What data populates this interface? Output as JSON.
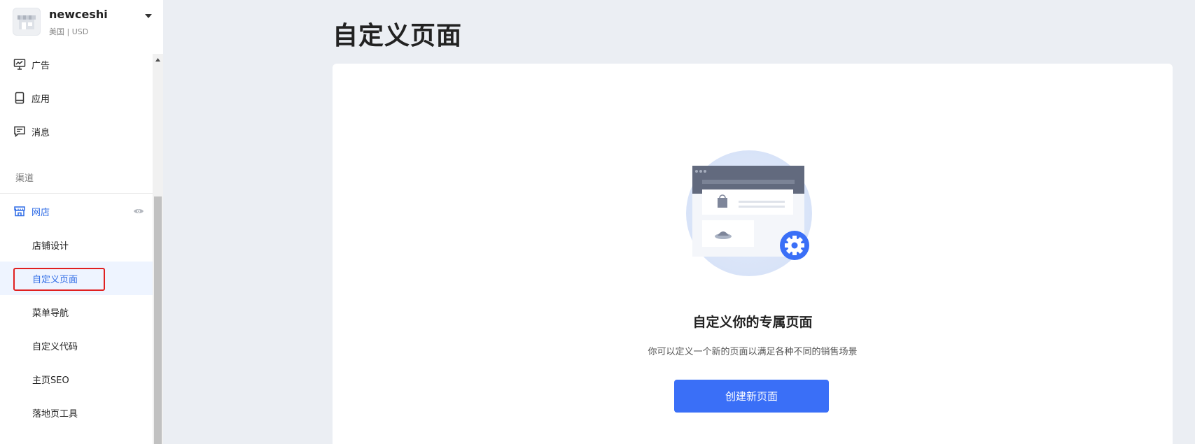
{
  "store": {
    "name": "newceshi",
    "region": "美国 | USD"
  },
  "sidebar": {
    "items": [
      {
        "label": "广告",
        "icon": "ad-monitor-icon"
      },
      {
        "label": "应用",
        "icon": "app-tablet-icon"
      },
      {
        "label": "消息",
        "icon": "message-icon"
      }
    ],
    "section_label": "渠道",
    "online_store": {
      "label": "网店",
      "icon": "store-icon",
      "visibility_icon": "eye-icon"
    },
    "sub_items": [
      {
        "label": "店铺设计"
      },
      {
        "label": "自定义页面"
      },
      {
        "label": "菜单导航"
      },
      {
        "label": "自定义代码"
      },
      {
        "label": "主页SEO"
      },
      {
        "label": "落地页工具"
      }
    ],
    "selected_sub_item": "自定义页面"
  },
  "main": {
    "page_title": "自定义页面",
    "empty_state": {
      "title": "自定义你的专属页面",
      "description": "你可以定义一个新的页面以满足各种不同的销售场景",
      "button_label": "创建新页面"
    }
  },
  "colors": {
    "accent": "#3a6ff7",
    "active_text": "#2e6be6",
    "selected_bg": "#eef4ff",
    "highlight_border": "#e02020",
    "page_bg": "#ebeef3"
  }
}
